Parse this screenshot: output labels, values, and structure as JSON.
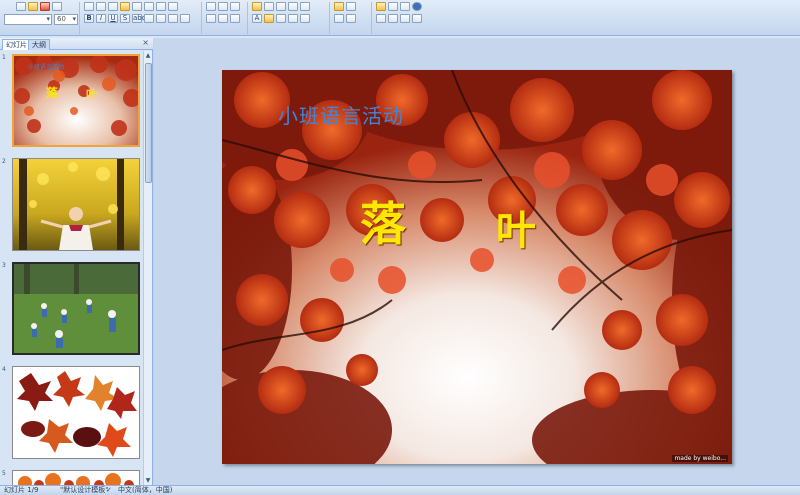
{
  "ribbon": {
    "font_name": "",
    "font_size": "60",
    "bold_label": "B",
    "italic_label": "I",
    "underline_label": "U",
    "shadow_label": "S",
    "strike_label": "abc",
    "font_color_label": "A"
  },
  "panel": {
    "tab_slides": "幻灯片",
    "tab_outline": "大纲",
    "close_label": "×",
    "slides": [
      {
        "number": "1",
        "title_main": "落",
        "title_main2": "叶",
        "subtitle": "小班语言活动"
      },
      {
        "number": "2"
      },
      {
        "number": "3"
      },
      {
        "number": "4"
      },
      {
        "number": "5"
      }
    ]
  },
  "slide": {
    "subtitle": "小班语言活动",
    "title_char_1": "落",
    "title_char_2": "叶",
    "watermark": "made by weibo..."
  },
  "status": {
    "slide_indicator": "幻灯片 1/9",
    "theme": "\"默认设计模板\"",
    "language": "中文(简体，中国)"
  },
  "colors": {
    "title_yellow": "#ffe800",
    "subtitle_blue": "#3f86d8",
    "selected_border": "#f0a33a"
  }
}
